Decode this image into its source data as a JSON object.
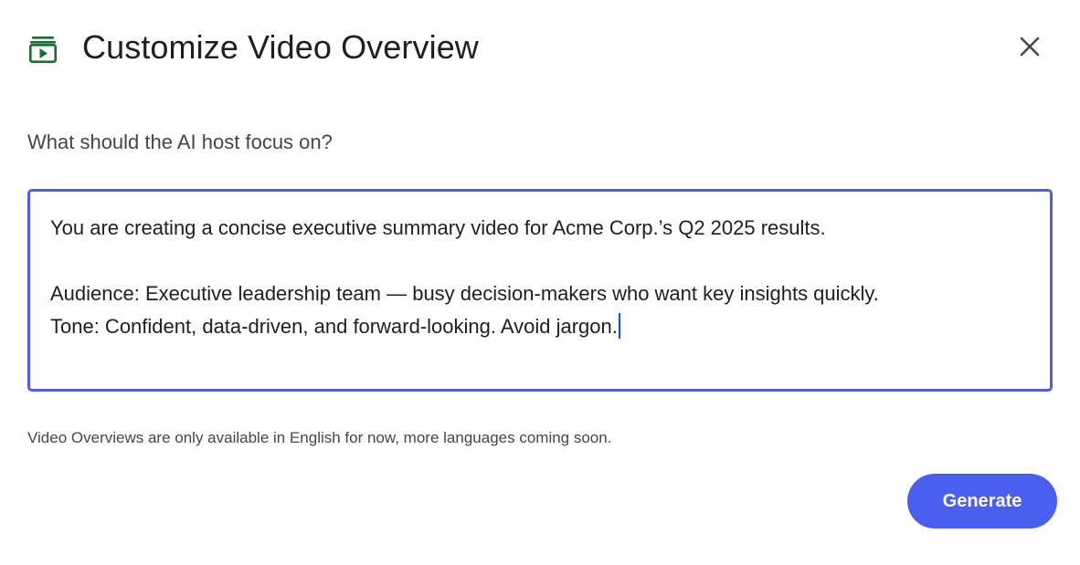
{
  "dialog": {
    "title": "Customize Video Overview",
    "header_icon": "video-stack-icon",
    "close_icon": "close-icon"
  },
  "prompt": {
    "label": "What should the AI host focus on?",
    "value_line1": "You are creating a concise executive summary video for Acme Corp.’s Q2 2025 results.",
    "value_line2": "",
    "value_line3": "Audience: Executive leadership team — busy decision-makers who want key insights quickly.",
    "value_line4": "Tone: Confident, data-driven, and forward-looking. Avoid jargon."
  },
  "footnote": "Video Overviews are only available in English for now, more languages coming soon.",
  "actions": {
    "generate_label": "Generate"
  },
  "colors": {
    "accent": "#4a5ef0",
    "focus_border": "#4f5fe0",
    "icon_green": "#1e6b33"
  }
}
